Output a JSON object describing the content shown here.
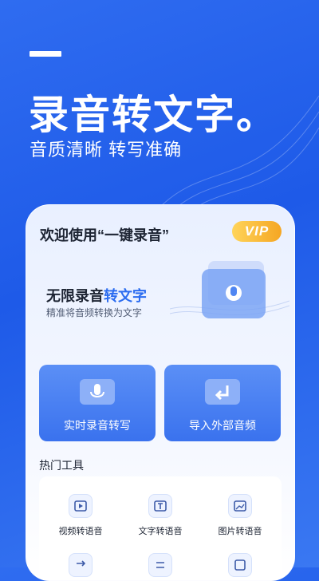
{
  "hero": {
    "headline": "录音转文字。",
    "subline": "音质清晰 转写准确"
  },
  "card": {
    "welcome": "欢迎使用“一键录音”",
    "vip_badge": "VIP",
    "feature_title_prefix": "无限录音",
    "feature_title_highlight": "转文字",
    "feature_subtitle": "精准将音频转换为文字"
  },
  "actions": [
    {
      "label": "实时录音转写",
      "icon": "microphone-folder-icon"
    },
    {
      "label": "导入外部音频",
      "icon": "import-folder-icon"
    }
  ],
  "tools_section": {
    "title": "热门工具",
    "items": [
      {
        "label": "视频转语音",
        "icon": "video-play-icon"
      },
      {
        "label": "文字转语音",
        "icon": "text-icon"
      },
      {
        "label": "图片转语音",
        "icon": "image-icon"
      }
    ]
  },
  "colors": {
    "background": "#1e5ae8",
    "accent": "#2b6cf0",
    "vip_gold": "#f5a623"
  }
}
